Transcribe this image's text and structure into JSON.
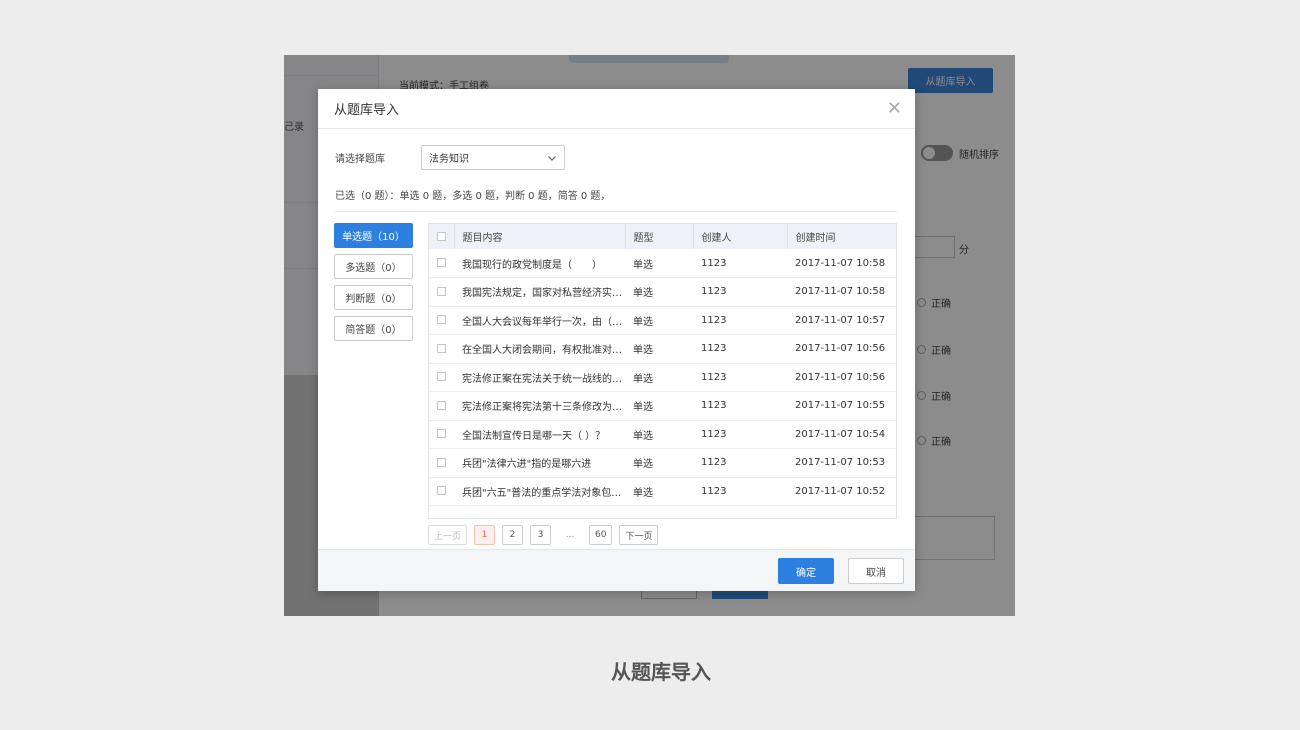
{
  "background": {
    "sidebar_text": "己录",
    "mode_text": "当前模式：手工组卷",
    "import_button": "从题库导入",
    "sort_label": "随机排序",
    "score_unit": "分",
    "correct_label": "正确"
  },
  "modal": {
    "title": "从题库导入",
    "bank_label": "请选择题库",
    "bank_value": "法务知识",
    "summary": "已选（0 题）：单选 0 题，多选 0 题，判断 0 题，简答 0 题，",
    "type_tabs": [
      {
        "label": "单选题（10）",
        "active": true
      },
      {
        "label": "多选题（0）",
        "active": false
      },
      {
        "label": "判断题（0）",
        "active": false
      },
      {
        "label": "简答题（0）",
        "active": false
      }
    ],
    "columns": [
      "题目内容",
      "题型",
      "创建人",
      "创建时间"
    ],
    "rows": [
      {
        "content": "我国现行的政党制度是（　　）",
        "type": "单选",
        "creator": "1123",
        "time": "2017-11-07 10:58"
      },
      {
        "content": "我国宪法规定，国家对私营经济实…",
        "type": "单选",
        "creator": "1123",
        "time": "2017-11-07 10:58"
      },
      {
        "content": "全国人大会议每年举行一次，由（…",
        "type": "单选",
        "creator": "1123",
        "time": "2017-11-07 10:57"
      },
      {
        "content": "在全国人大闭会期间，有权批准对…",
        "type": "单选",
        "creator": "1123",
        "time": "2017-11-07 10:56"
      },
      {
        "content": "宪法修正案在宪法关于统一战线的…",
        "type": "单选",
        "creator": "1123",
        "time": "2017-11-07 10:56"
      },
      {
        "content": "宪法修正案将宪法第十三条修改为…",
        "type": "单选",
        "creator": "1123",
        "time": "2017-11-07 10:55"
      },
      {
        "content": "全国法制宣传日是哪一天（ ）？",
        "type": "单选",
        "creator": "1123",
        "time": "2017-11-07 10:54"
      },
      {
        "content": "兵团\"法律六进\"指的是哪六进",
        "type": "单选",
        "creator": "1123",
        "time": "2017-11-07 10:53"
      },
      {
        "content": "兵团\"六五\"普法的重点学法对象包…",
        "type": "单选",
        "creator": "1123",
        "time": "2017-11-07 10:52"
      }
    ],
    "pagination": {
      "prev": "上一页",
      "pages": [
        "1",
        "2",
        "3"
      ],
      "current": "1",
      "ellipsis": "...",
      "last": "60",
      "next": "下一页"
    },
    "ok_label": "确定",
    "cancel_label": "取消"
  },
  "caption": "从题库导入",
  "colors": {
    "primary": "#2d7fe0",
    "current_page": "#e06a4a",
    "overlay": "rgba(0,0,0,0.45)"
  }
}
